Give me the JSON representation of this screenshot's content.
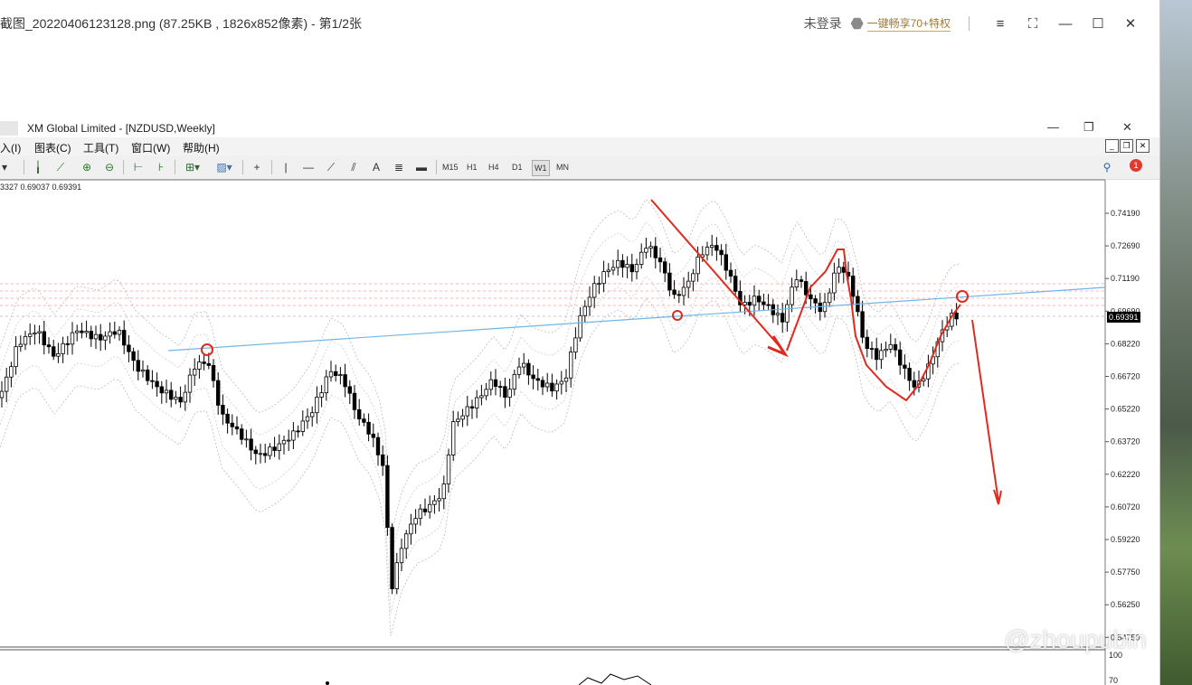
{
  "viewer": {
    "title": "截图_20220406123128.png (87.25KB , 1826x852像素) - 第1/2张",
    "login": "未登录",
    "promo": "一键畅享70+特权",
    "buttons": [
      "≡",
      "⛶",
      "—",
      "☐",
      "✕"
    ]
  },
  "mt4": {
    "title": "XM Global Limited - [NZDUSD,Weekly]",
    "menu": [
      "入(I)",
      "图表(C)",
      "工具(T)",
      "窗口(W)",
      "帮助(H)"
    ],
    "timeframes": [
      "M15",
      "H1",
      "H4",
      "D1",
      "W1",
      "MN"
    ],
    "active_timeframe": "W1",
    "ohlc": "3327 0.69037 0.69391",
    "notifications": "1",
    "current_price": "0.69391",
    "price_ticks": [
      "0.74190",
      "0.72690",
      "0.71190",
      "0.69690",
      "0.68220",
      "0.66720",
      "0.65220",
      "0.63720",
      "0.62220",
      "0.60720",
      "0.59220",
      "0.57750",
      "0.56250",
      "0.54750"
    ],
    "sub_ticks": [
      "100",
      "70"
    ]
  },
  "watermark": "@zhoupubin",
  "colors": {
    "up": "#000000",
    "down": "#000000",
    "trend": "#6fb6e8",
    "annotation": "#e02a1f"
  }
}
